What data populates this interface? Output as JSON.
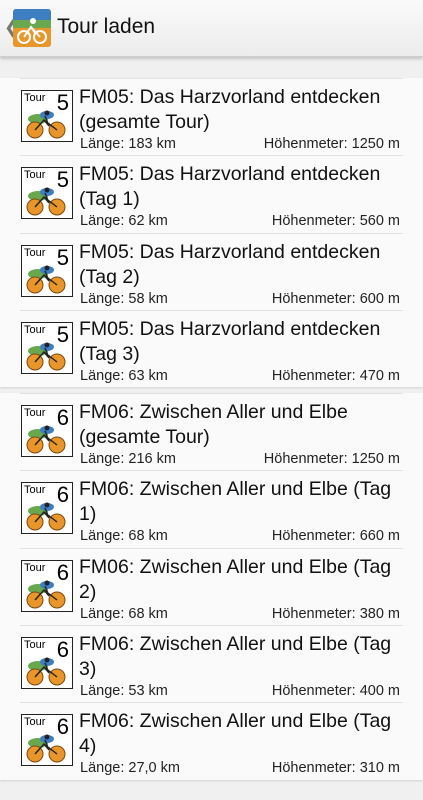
{
  "header": {
    "title": "Tour laden",
    "back_icon": "chevron-left-icon",
    "app_icon": "cyclist-app-icon"
  },
  "groups": [
    {
      "tour_label": "Tour",
      "tour_number": "5",
      "items": [
        {
          "title": "FM05: Das Harzvorland entdecken (gesamte Tour)",
          "length": "Länge: 183 km",
          "height": "Höhenmeter: 1250 m"
        },
        {
          "title": "FM05: Das Harzvorland entdecken (Tag 1)",
          "length": "Länge: 62 km",
          "height": "Höhenmeter: 560 m"
        },
        {
          "title": "FM05: Das Harzvorland entdecken (Tag 2)",
          "length": "Länge: 58 km",
          "height": "Höhenmeter: 600 m"
        },
        {
          "title": "FM05: Das Harzvorland entdecken (Tag 3)",
          "length": "Länge: 63 km",
          "height": "Höhenmeter: 470 m"
        }
      ]
    },
    {
      "tour_label": "Tour",
      "tour_number": "6",
      "items": [
        {
          "title": "FM06: Zwischen Aller und Elbe (gesamte Tour)",
          "length": "Länge: 216 km",
          "height": "Höhenmeter: 1250 m"
        },
        {
          "title": "FM06: Zwischen Aller und Elbe (Tag 1)",
          "length": "Länge: 68 km",
          "height": "Höhenmeter: 660 m"
        },
        {
          "title": "FM06: Zwischen Aller und Elbe (Tag 2)",
          "length": "Länge: 68 km",
          "height": "Höhenmeter: 380 m"
        },
        {
          "title": "FM06: Zwischen Aller und Elbe (Tag 3)",
          "length": "Länge: 53 km",
          "height": "Höhenmeter: 400 m"
        },
        {
          "title": "FM06: Zwischen Aller und Elbe (Tag 4)",
          "length": "Länge: 27,0 km",
          "height": "Höhenmeter: 310 m"
        }
      ]
    }
  ],
  "colors": {
    "accent_orange": "#e8952a",
    "accent_green": "#6aa84f",
    "accent_blue": "#3d7fc1"
  }
}
